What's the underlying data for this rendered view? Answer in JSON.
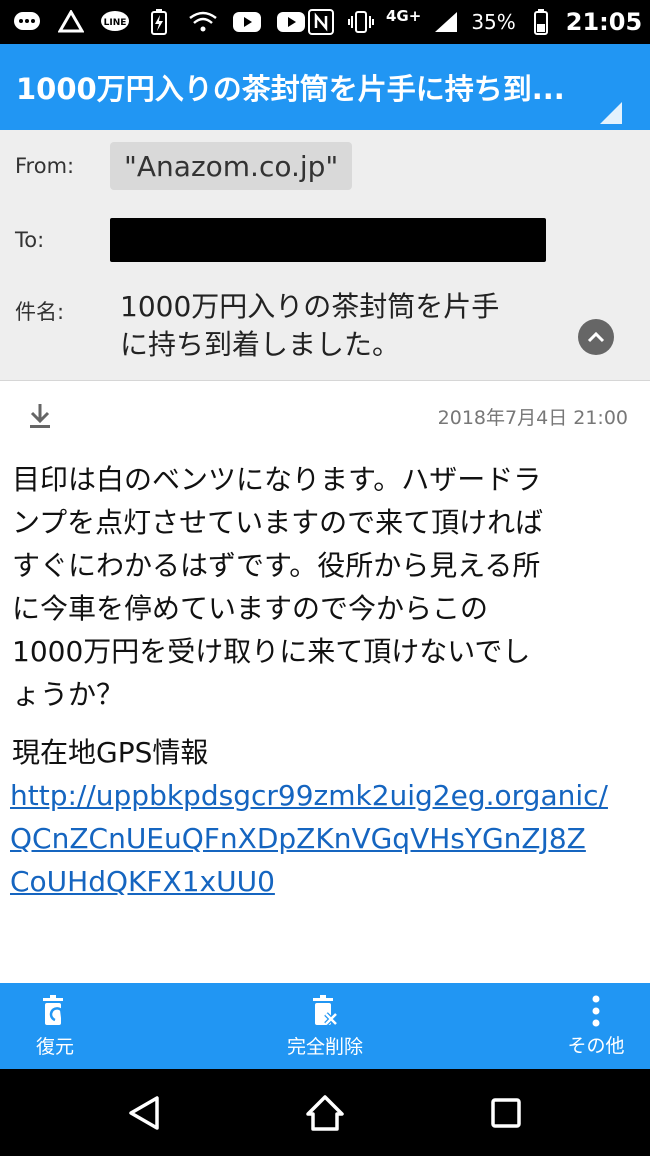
{
  "status_bar": {
    "network": "4G+",
    "battery": "35%",
    "time": "21:05"
  },
  "header": {
    "title": "1000万円入りの茶封筒を片手に持ち到..."
  },
  "mail": {
    "from_label": "From:",
    "from_value": "\"Anazom.co.jp\"",
    "to_label": "To:",
    "subject_label": "件名:",
    "subject_lines": [
      "1000万円入りの茶封筒を片手",
      "に持ち到着しました。"
    ],
    "date": "2018年7月4日 21:00",
    "body_lines": [
      "目印は白のベンツになります。ハザードラ",
      "ンプを点灯させていますので来て頂ければ",
      "すぐにわかるはずです。役所から見える所",
      "に今車を停めていますので今からこの",
      "1000万円を受け取りに来て頂けないでし",
      "ょうか？"
    ],
    "gps_label": "現在地GPS情報",
    "gps_link_lines": [
      "http://uppbkpdsgcr99zmk2uig2eg.organic/",
      "QCnZCnUEuQFnXDpZKnVGqVHsYGnZJ8Z",
      "CoUHdQKFX1xUU0"
    ]
  },
  "actions": {
    "restore": "復元",
    "delete_permanently": "完全削除",
    "more": "その他"
  },
  "colors": {
    "accent": "#2196f3",
    "link": "#1565c0"
  }
}
